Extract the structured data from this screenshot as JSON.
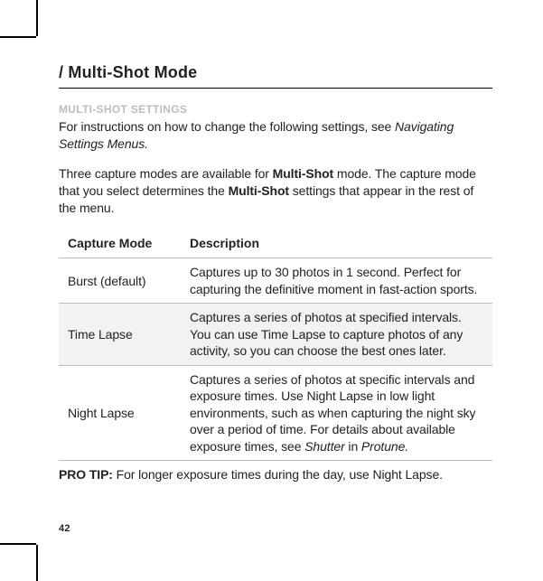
{
  "chapter_title": "/ Multi-Shot Mode",
  "section_heading": "MULTI-SHOT SETTINGS",
  "intro_line1": "For instructions on how to change the following settings, see ",
  "intro_ref": "Navigating Settings Menus.",
  "intro2_pre": "Three capture modes are available for ",
  "intro2_bold1": "Multi-Shot",
  "intro2_mid": " mode. The capture mode that you select determines the ",
  "intro2_bold2": "Multi-Shot",
  "intro2_post": " settings that appear in the rest of the menu.",
  "table": {
    "headers": {
      "mode": "Capture Mode",
      "desc": "Description"
    },
    "rows": [
      {
        "mode": "Burst (default)",
        "desc_pre": "Captures up to 30 photos in 1 second. Perfect for capturing the definitive moment in fast-action sports.",
        "desc_italic1": "",
        "desc_mid": "",
        "desc_italic2": ""
      },
      {
        "mode": "Time Lapse",
        "desc_pre": "Captures a series of photos at specified intervals. You can use Time Lapse to capture photos of any activity, so you can choose the best ones later.",
        "desc_italic1": "",
        "desc_mid": "",
        "desc_italic2": ""
      },
      {
        "mode": "Night Lapse",
        "desc_pre": "Captures a series of photos at specific intervals and exposure times. Use Night Lapse in low light environments, such as when capturing the night sky over a period of time. For details about available exposure times, see ",
        "desc_italic1": "Shutter",
        "desc_mid": " in ",
        "desc_italic2": "Protune."
      }
    ]
  },
  "protip_label": "PRO TIP: ",
  "protip_text": "For longer exposure times during the day, use Night Lapse.",
  "page_number": "42"
}
